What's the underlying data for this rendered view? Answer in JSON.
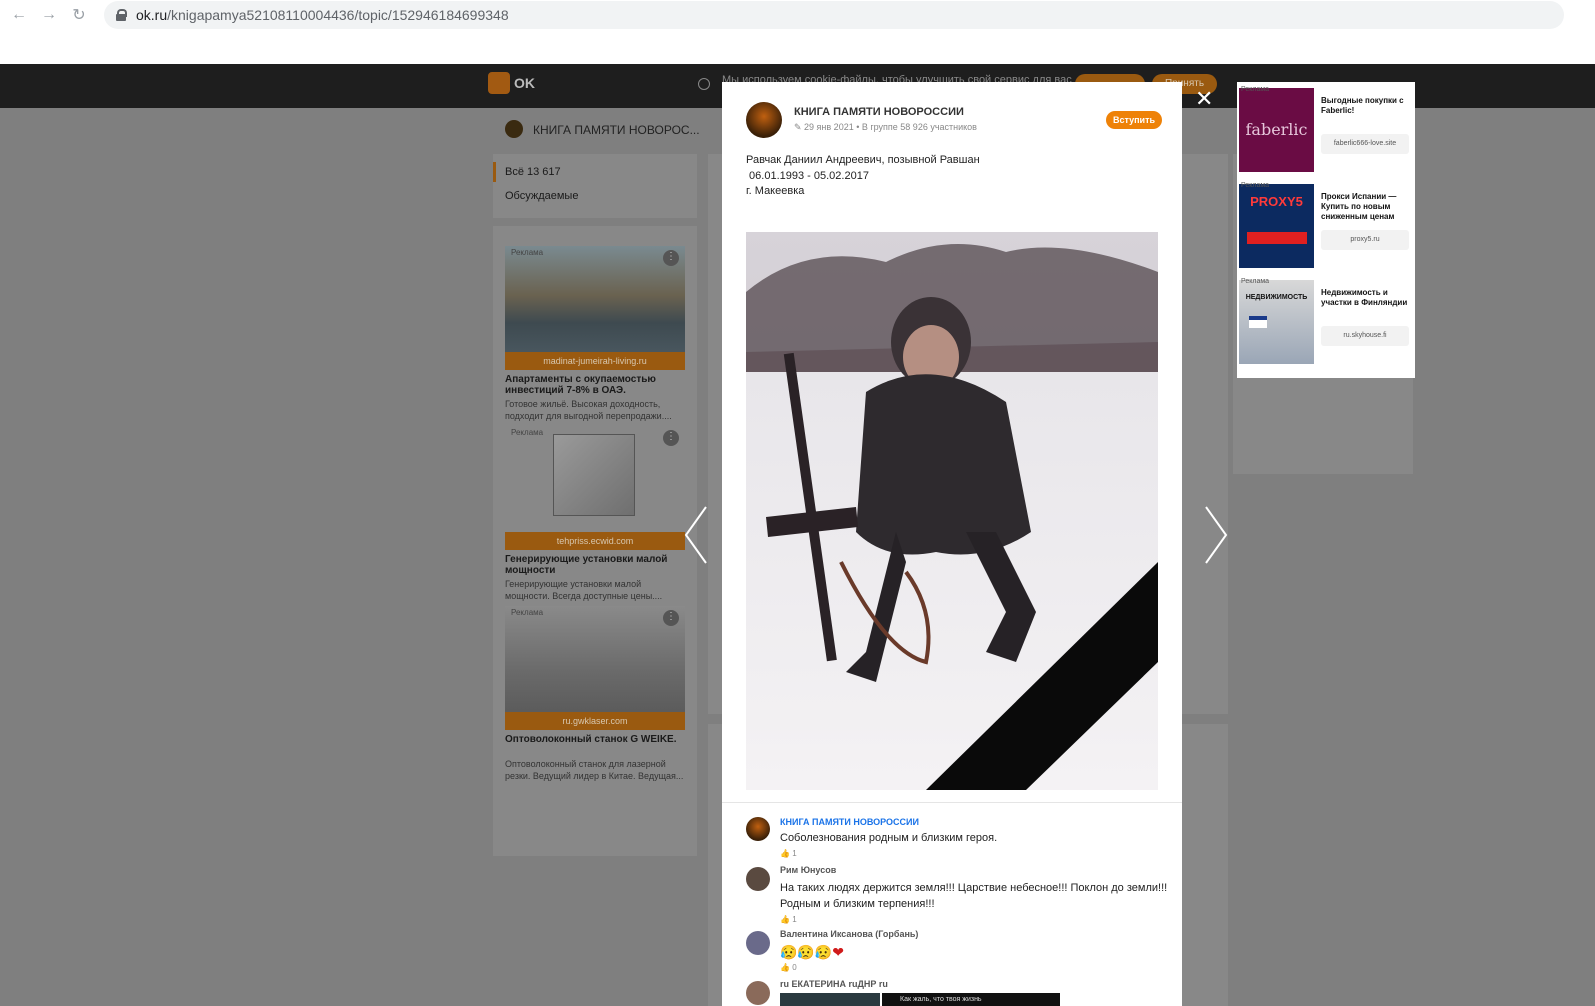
{
  "browser": {
    "url_host": "ok.ru",
    "url_path": "/knigapamya52108110004436/topic/152946184699348"
  },
  "site": {
    "logo_text": "OK",
    "cookie_text": "Мы используем cookie-файлы, чтобы улучшить свой сервис для вас",
    "cookie_button": "Принять"
  },
  "group_header": {
    "name": "КНИГА ПАМЯТИ НОВОРОС..."
  },
  "left_menu": {
    "items": [
      "Всё 13 617",
      "Обсуждаемые"
    ]
  },
  "left_ads": [
    {
      "label": "Реклама",
      "url": "madinat-jumeirah-living.ru",
      "title": "Апартаменты с окупаемостью инвестиций 7-8% в ОАЭ.",
      "desc": "Готовое жильё. Высокая доходность, подходит для выгодной перепродажи...."
    },
    {
      "label": "Реклама",
      "url": "tehpriss.ecwid.com",
      "title": "Генерирующие установки малой мощности",
      "desc": "Генерирующие установки малой мощности. Всегда доступные цены...."
    },
    {
      "label": "Реклама",
      "url": "ru.gwklaser.com",
      "title": "Оптоволоконный станок G WEIKE.",
      "desc": "Оптоволоконный станок для лазерной резки. Ведущий лидер в Китае. Ведущая..."
    }
  ],
  "post": {
    "group_name": "КНИГА ПАМЯТИ НОВОРОССИИ",
    "meta": "29 янв 2021 • В группе 58 926 участников",
    "join_button": "Вступить",
    "line1": "Равчак Даниил Андреевич, позывной Равшан",
    "line2": " 06.01.1993 - 05.02.2017",
    "line3": "г. Макеевка"
  },
  "comments": [
    {
      "author": "КНИГА ПАМЯТИ НОВОРОССИИ",
      "text": "Соболезнования родным и близким героя.",
      "likes": "1",
      "author_color": "#1a73e8"
    },
    {
      "author": "Рим Юнусов",
      "text": "На таких людях держится земля!!! Царствие небесное!!! Поклон до земли!!!",
      "text2": "Родным и близким терпения!!!",
      "likes": "1",
      "author_color": "#555555"
    },
    {
      "author": "Валентина Иксанова (Горбань)",
      "text": "",
      "likes": "0",
      "author_color": "#555555"
    },
    {
      "author": "ru ЕКАТЕРИНА ruДНР ru",
      "text": "",
      "likes": "",
      "author_color": "#555555",
      "image_caption": "Как жаль, что твоя жизнь"
    }
  ],
  "right_ads": [
    {
      "label": "Реклама",
      "title": "Выгодные покупки с Faberlic!",
      "url": "faberlic666-love.site",
      "brand": "faberlic"
    },
    {
      "label": "Реклама",
      "title": "Прокси Испании — Купить по новым сниженным ценам",
      "url": "proxy5.ru",
      "brand": "PROXY5"
    },
    {
      "label": "Реклама",
      "title": "Недвижимость и участки в Финляндии",
      "url": "ru.skyhouse.fi",
      "brand": "НЕДВИЖИМОСТЬ"
    }
  ],
  "colors": {
    "accent": "#ee8208",
    "overlay": "#7f7f7f",
    "topbar": "#1e1e1e"
  }
}
